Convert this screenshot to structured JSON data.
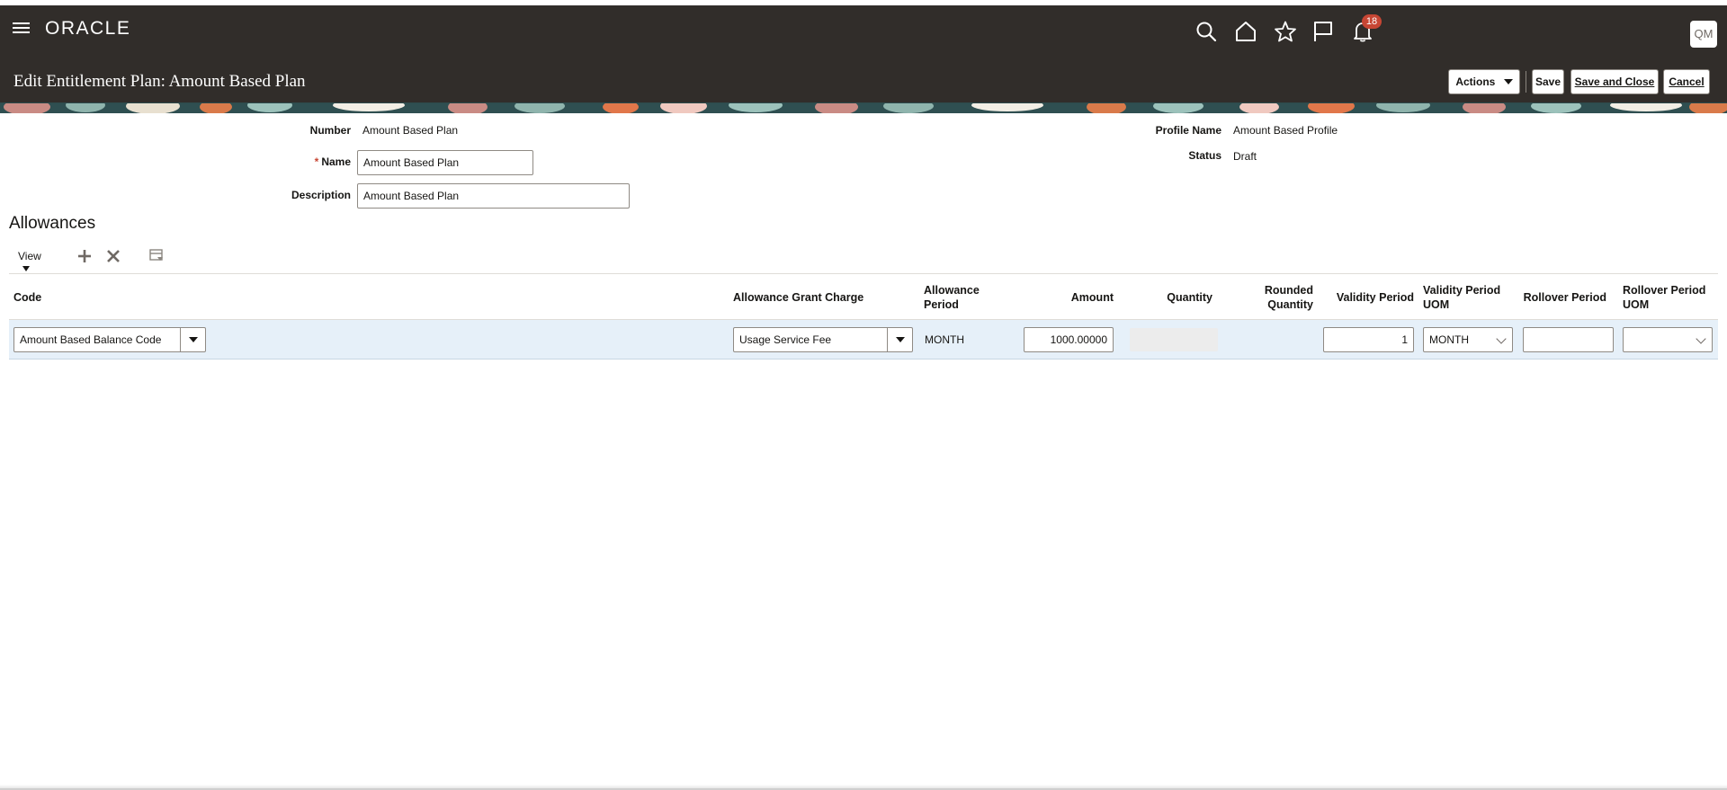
{
  "app": {
    "logo": "ORACLE",
    "page_title": "Edit Entitlement Plan: Amount Based Plan",
    "notifications_count": "18",
    "user_initials": "QM"
  },
  "header_actions": {
    "actions_label": "Actions",
    "save_label": "Save",
    "save_close_label": "Save and Close",
    "cancel_label": "Cancel"
  },
  "form": {
    "number_label": "Number",
    "number_value": "Amount Based Plan",
    "name_label": "Name",
    "name_value": "Amount Based Plan",
    "description_label": "Description",
    "description_value": "Amount Based Plan",
    "profile_name_label": "Profile Name",
    "profile_name_value": "Amount Based Profile",
    "status_label": "Status",
    "status_value": "Draft"
  },
  "allowances": {
    "title": "Allowances",
    "view_label": "View",
    "columns": {
      "code": "Code",
      "grant_charge": "Allowance Grant Charge",
      "period_1": "Allowance",
      "period_2": "Period",
      "amount": "Amount",
      "quantity": "Quantity",
      "rounded_1": "Rounded",
      "rounded_2": "Quantity",
      "validity_period": "Validity Period",
      "validity_uom_1": "Validity Period",
      "validity_uom_2": "UOM",
      "rollover_period": "Rollover Period",
      "rollover_uom_1": "Rollover Period",
      "rollover_uom_2": "UOM"
    },
    "row": {
      "code": "Amount Based Balance Code",
      "grant_charge": "Usage Service Fee",
      "period": "MONTH",
      "amount": "1000.00000",
      "validity_period": "1",
      "validity_uom": "MONTH",
      "rollover_period": "",
      "rollover_uom": ""
    }
  }
}
